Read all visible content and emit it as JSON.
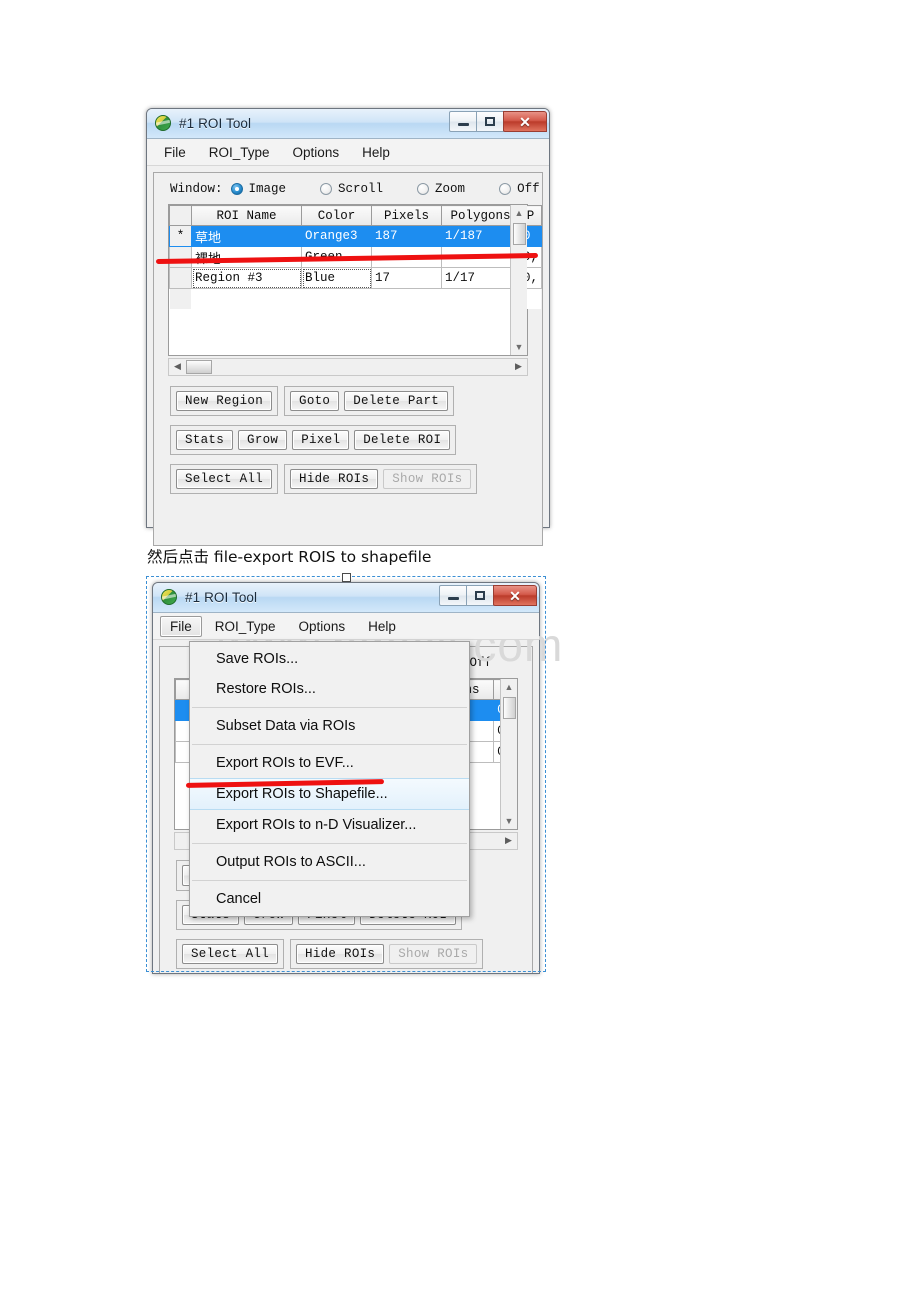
{
  "page": {
    "watermark": "www.bdocx.com",
    "caption": "然后点击 file-export ROIS to shapefile"
  },
  "window1": {
    "title": "#1 ROI Tool",
    "icon": "roi-globe-icon",
    "controls": {
      "minimize": "–",
      "maximize": "❐",
      "close": "✕"
    },
    "menus": [
      "File",
      "ROI_Type",
      "Options",
      "Help"
    ],
    "window_row": {
      "label": "Window:",
      "options": [
        {
          "label": "Image",
          "selected": true
        },
        {
          "label": "Scroll",
          "selected": false
        },
        {
          "label": "Zoom",
          "selected": false
        },
        {
          "label": "Off",
          "selected": false
        }
      ]
    },
    "table": {
      "columns": [
        "",
        "ROI Name",
        "Color",
        "Pixels",
        "Polygons",
        "P"
      ],
      "rows": [
        {
          "mark": "*",
          "name": "草地",
          "color": "Orange3",
          "pixels": "187",
          "polygons": "1/187",
          "p": "0",
          "selected": true
        },
        {
          "mark": "",
          "name": "裸地",
          "color": "Green",
          "pixels": "",
          "polygons": "",
          "p": "0,",
          "selected": false
        },
        {
          "mark": "",
          "name": "Region #3",
          "color": "Blue",
          "pixels": "17",
          "polygons": "1/17",
          "p": "0,",
          "selected": false
        }
      ]
    },
    "buttons": {
      "row1": [
        {
          "label": "New Region",
          "disabled": false
        },
        {
          "label": "Goto",
          "disabled": false
        },
        {
          "label": "Delete Part",
          "disabled": false
        }
      ],
      "row2": [
        {
          "label": "Stats",
          "disabled": false
        },
        {
          "label": "Grow",
          "disabled": false
        },
        {
          "label": "Pixel",
          "disabled": false
        },
        {
          "label": "Delete ROI",
          "disabled": false
        }
      ],
      "row3": [
        {
          "label": "Select All",
          "disabled": false
        },
        {
          "label": "Hide ROIs",
          "disabled": false
        },
        {
          "label": "Show ROIs",
          "disabled": true
        }
      ]
    }
  },
  "window2": {
    "title": "#1 ROI Tool",
    "icon": "roi-globe-icon",
    "controls": {
      "minimize": "–",
      "maximize": "❐",
      "close": "✕"
    },
    "menus": [
      "File",
      "ROI_Type",
      "Options",
      "Help"
    ],
    "active_menu": "File",
    "file_menu": [
      {
        "label": "Save ROIs...",
        "highlighted": false,
        "sep_after": false
      },
      {
        "label": "Restore ROIs...",
        "highlighted": false,
        "sep_after": true
      },
      {
        "label": "Subset Data via ROIs",
        "highlighted": false,
        "sep_after": true
      },
      {
        "label": "Export ROIs to EVF...",
        "highlighted": false,
        "sep_after": false
      },
      {
        "label": "Export ROIs to Shapefile...",
        "highlighted": true,
        "sep_after": false
      },
      {
        "label": "Export ROIs to n-D Visualizer...",
        "highlighted": false,
        "sep_after": true
      },
      {
        "label": "Output ROIs to ASCII...",
        "highlighted": false,
        "sep_after": true
      },
      {
        "label": "Cancel",
        "highlighted": false,
        "sep_after": false
      }
    ],
    "visible_window_option": "Off",
    "table": {
      "columns": [
        "gons",
        "P"
      ],
      "rows": [
        {
          "polygons": "",
          "p": "0,",
          "selected": true
        },
        {
          "polygons": "",
          "p": "0,",
          "selected": false
        },
        {
          "polygons": "",
          "p": "0,",
          "selected": false
        }
      ]
    },
    "buttons": {
      "row2": [
        {
          "label": "Stats",
          "disabled": false
        },
        {
          "label": "Grow",
          "disabled": false
        },
        {
          "label": "Pixel",
          "disabled": false
        },
        {
          "label": "Delete ROI",
          "disabled": false
        }
      ],
      "row3": [
        {
          "label": "Select All",
          "disabled": false
        },
        {
          "label": "Hide ROIs",
          "disabled": false
        },
        {
          "label": "Show ROIs",
          "disabled": true
        }
      ]
    }
  },
  "annotations": {
    "stroke_color": "#ee1111",
    "strokes": [
      {
        "name": "underline-selected-roi-row"
      },
      {
        "name": "underline-export-shapefile-item"
      }
    ]
  }
}
